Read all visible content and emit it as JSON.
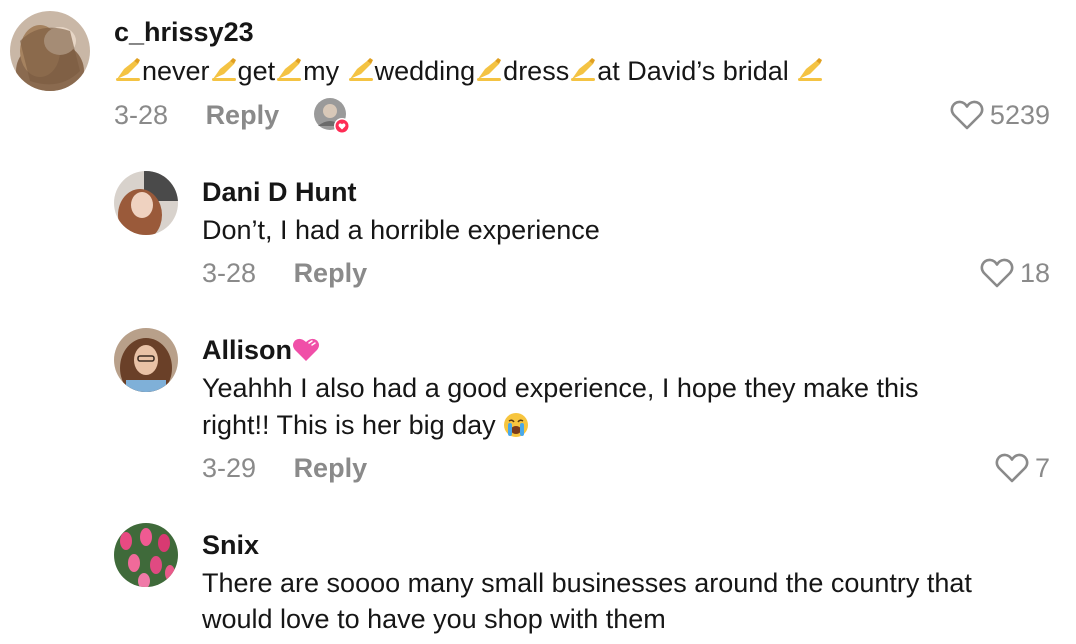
{
  "comments": [
    {
      "username": "c_hrissy23",
      "text_segments": [
        "never",
        "get",
        "my ",
        "wedding",
        "dress",
        "at David’s bridal "
      ],
      "date": "3-28",
      "reply_label": "Reply",
      "likes": "5239",
      "liked_by_creator_icon": "creator-liked-avatar"
    },
    {
      "username": "Dani D Hunt",
      "text": "Don’t, I had a horrible experience",
      "date": "3-28",
      "reply_label": "Reply",
      "likes": "18"
    },
    {
      "username": "Allison",
      "username_emoji": "pink-heart",
      "text_line1": "Yeahhh I also had a good experience, I hope they make this",
      "text_line2": "right!! This is her big day ",
      "text_emoji": "loudly-crying-face",
      "date": "3-29",
      "reply_label": "Reply",
      "likes": "7"
    },
    {
      "username": "Snix",
      "text_line1": "There are soooo many small businesses around the country that",
      "text_line2": "would love to have you shop with them"
    }
  ],
  "icons": {
    "like": "heart-outline-icon",
    "writing_hand": "writing-hand-emoji"
  }
}
